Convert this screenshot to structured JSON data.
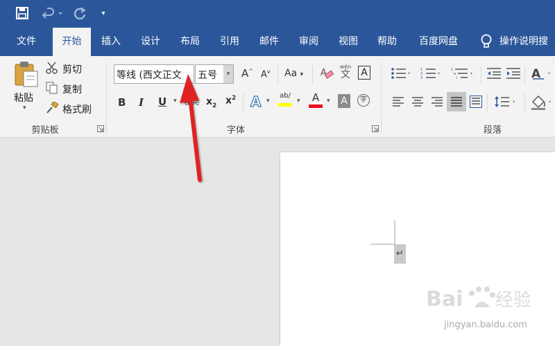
{
  "quick_access": {
    "save_icon": "save-icon",
    "undo_icon": "undo-icon",
    "redo_icon": "redo-icon",
    "customize_icon": "customize-qat-icon"
  },
  "tabs": [
    {
      "label": "文件"
    },
    {
      "label": "开始",
      "active": true
    },
    {
      "label": "插入"
    },
    {
      "label": "设计"
    },
    {
      "label": "布局"
    },
    {
      "label": "引用"
    },
    {
      "label": "邮件"
    },
    {
      "label": "审阅"
    },
    {
      "label": "视图"
    },
    {
      "label": "帮助"
    },
    {
      "label": "百度网盘"
    }
  ],
  "tell_me": {
    "label": "操作说明搜"
  },
  "clipboard": {
    "paste_label": "粘贴",
    "cut_label": "剪切",
    "copy_label": "复制",
    "format_painter_label": "格式刷",
    "group_label": "剪贴板"
  },
  "font": {
    "name_value": "等线 (西文正文",
    "size_value": "五号",
    "group_label": "字体",
    "bold": "B",
    "italic": "I",
    "underline": "U",
    "strikethrough": "abc",
    "subscript": "x2",
    "superscript": "x2",
    "change_case": "Aa",
    "phonetic_top": "wén",
    "phonetic_bottom": "文",
    "char_border": "A",
    "font_color": "A",
    "char_shading": "A",
    "enclose": "字",
    "grow": "A",
    "shrink": "A"
  },
  "paragraph": {
    "group_label": "段落"
  },
  "colors": {
    "ribbon_blue": "#2b579a",
    "highlight_yellow": "#ffff00",
    "font_red": "#e81123",
    "annotation_red": "#e02020"
  },
  "watermark": {
    "logo_text": "Bai",
    "logo_suffix": "经验",
    "url": "jingyan.baidu.com"
  }
}
